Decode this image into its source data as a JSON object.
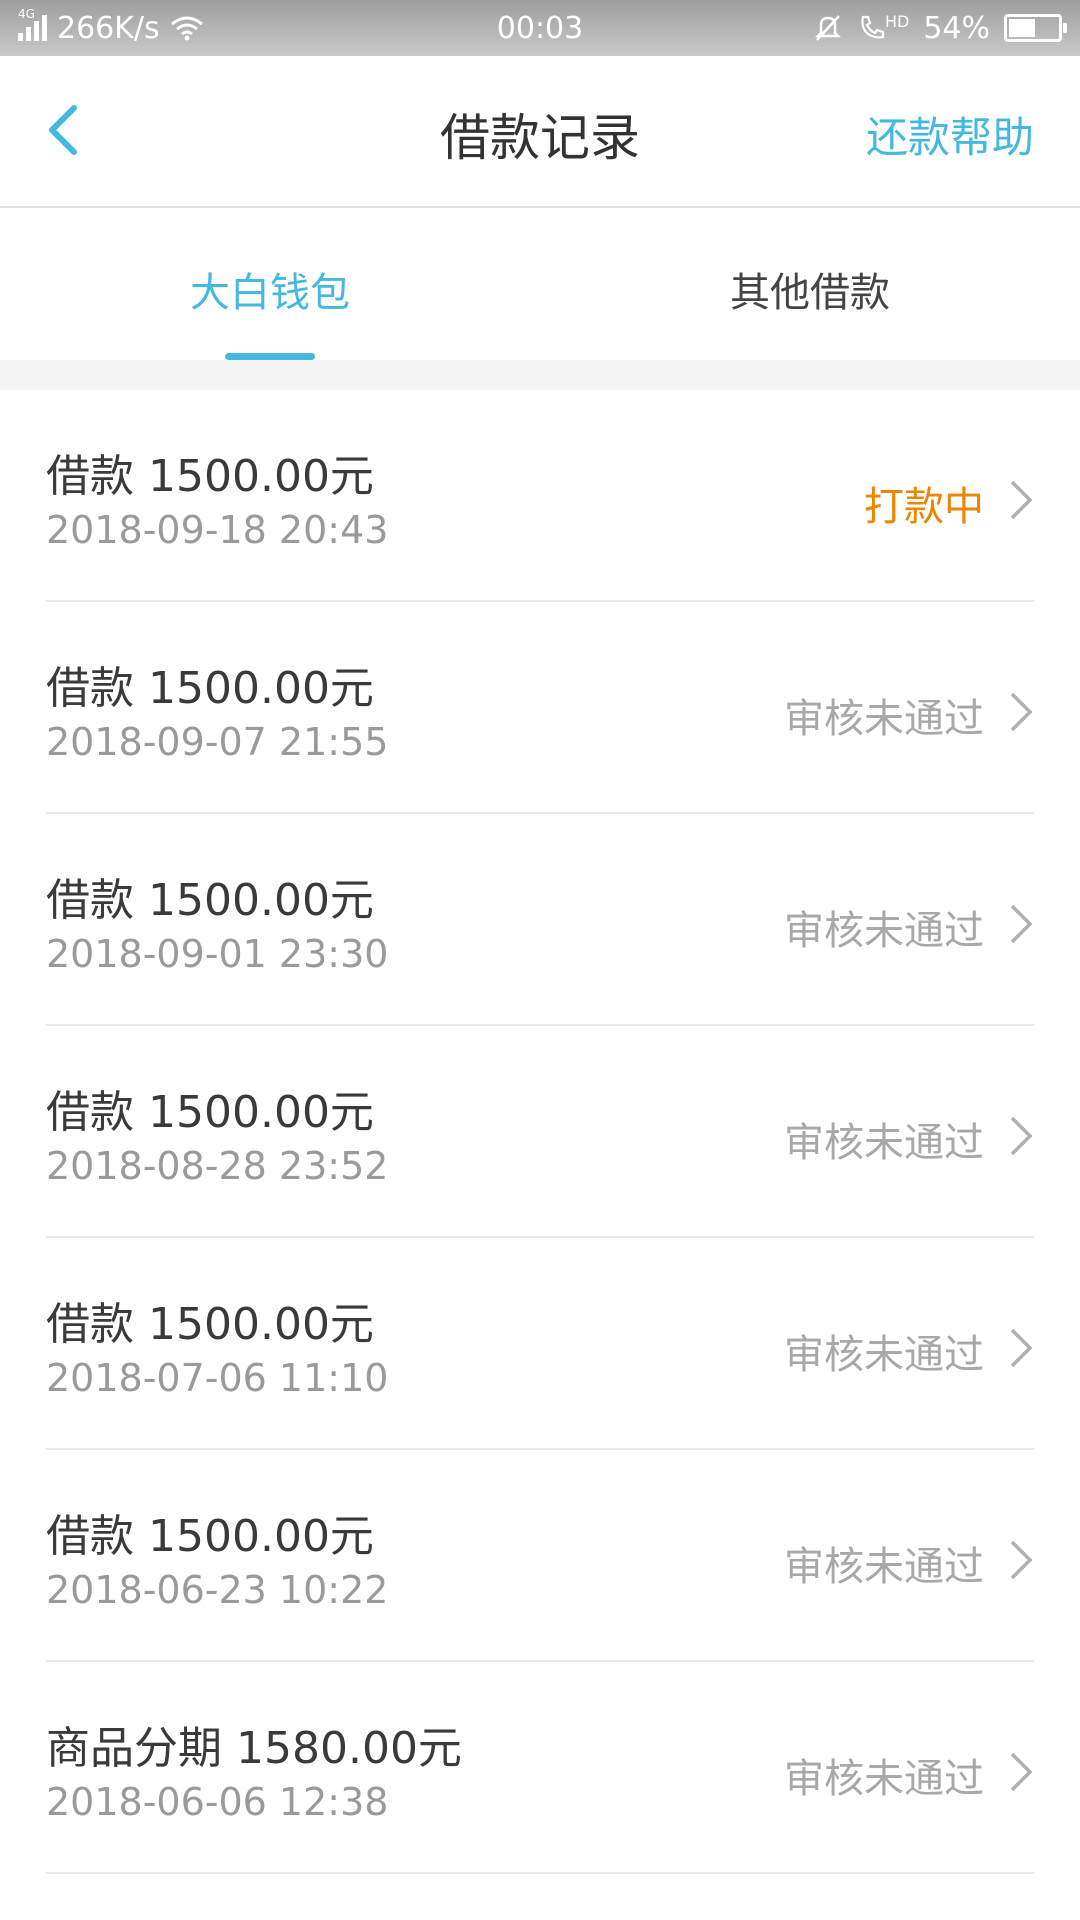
{
  "status_bar": {
    "network": "4G",
    "speed": "266K/s",
    "time": "00:03",
    "hd": "HD",
    "battery": "54%",
    "battery_level": 0.54
  },
  "header": {
    "title": "借款记录",
    "help": "还款帮助"
  },
  "tabs": [
    {
      "label": "大白钱包",
      "active": true
    },
    {
      "label": "其他借款",
      "active": false
    }
  ],
  "records": [
    {
      "title": "借款 1500.00元",
      "date": "2018-09-18 20:43",
      "status": "打款中",
      "pending": true
    },
    {
      "title": "借款 1500.00元",
      "date": "2018-09-07 21:55",
      "status": "审核未通过",
      "pending": false
    },
    {
      "title": "借款 1500.00元",
      "date": "2018-09-01 23:30",
      "status": "审核未通过",
      "pending": false
    },
    {
      "title": "借款 1500.00元",
      "date": "2018-08-28 23:52",
      "status": "审核未通过",
      "pending": false
    },
    {
      "title": "借款 1500.00元",
      "date": "2018-07-06 11:10",
      "status": "审核未通过",
      "pending": false
    },
    {
      "title": "借款 1500.00元",
      "date": "2018-06-23 10:22",
      "status": "审核未通过",
      "pending": false
    },
    {
      "title": "商品分期 1580.00元",
      "date": "2018-06-06 12:38",
      "status": "审核未通过",
      "pending": false
    }
  ],
  "colors": {
    "accent": "#45b8e0",
    "pending": "#f08300",
    "muted": "#a8a8a8"
  }
}
